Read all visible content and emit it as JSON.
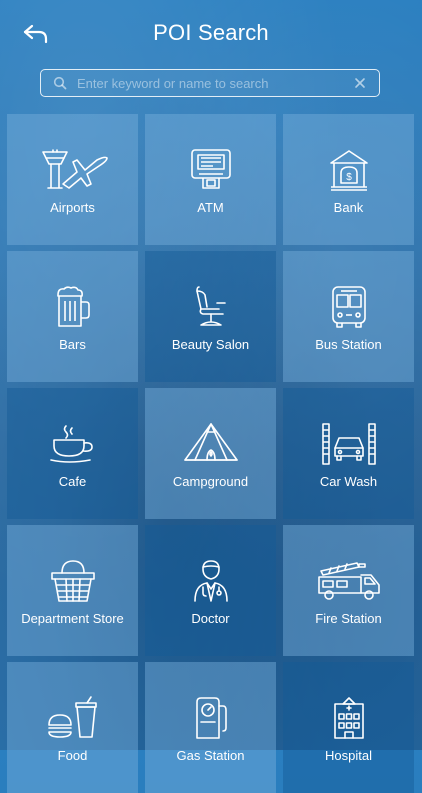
{
  "header": {
    "title": "POI Search",
    "back_icon": "back-arrow-icon"
  },
  "search": {
    "placeholder": "Enter keyword or name to search",
    "value": "",
    "clear_icon": "close-icon"
  },
  "categories": [
    {
      "label": "Airports",
      "icon": "airport-icon"
    },
    {
      "label": "ATM",
      "icon": "atm-icon"
    },
    {
      "label": "Bank",
      "icon": "bank-icon"
    },
    {
      "label": "Bars",
      "icon": "beer-mug-icon"
    },
    {
      "label": "Beauty Salon",
      "icon": "salon-chair-icon"
    },
    {
      "label": "Bus Station",
      "icon": "bus-icon"
    },
    {
      "label": "Cafe",
      "icon": "coffee-cup-icon"
    },
    {
      "label": "Campground",
      "icon": "tent-icon"
    },
    {
      "label": "Car Wash",
      "icon": "car-wash-icon"
    },
    {
      "label": "Department Store",
      "icon": "shopping-basket-icon"
    },
    {
      "label": "Doctor",
      "icon": "doctor-icon"
    },
    {
      "label": "Fire Station",
      "icon": "fire-truck-icon"
    },
    {
      "label": "Food",
      "icon": "fast-food-icon"
    },
    {
      "label": "Gas Station",
      "icon": "gas-pump-icon"
    },
    {
      "label": "Hospital",
      "icon": "hospital-building-icon"
    }
  ],
  "colors": {
    "background": "#2d78b5",
    "tile_light": "#78afdc",
    "tile_dark": "#145a96",
    "text": "#ffffff"
  }
}
